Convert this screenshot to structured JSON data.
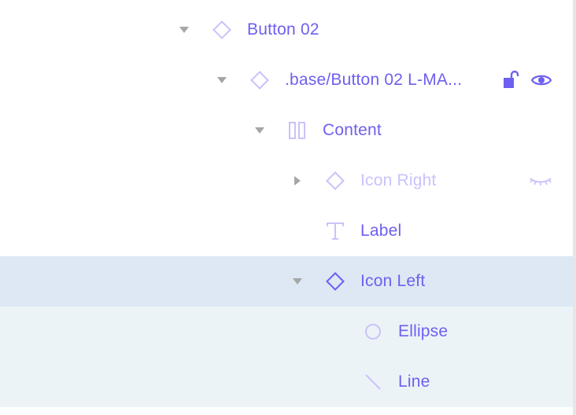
{
  "colors": {
    "accent": "#6e5ff0",
    "accent_light": "#c9c3fb",
    "caret": "#a6a6a6",
    "selected_bg": "#dde8f4",
    "child_bg": "#ebf3f7"
  },
  "layers": [
    {
      "name": "Button 02",
      "type": "component-instance",
      "icon": "diamond-icon",
      "depth": 0,
      "expanded": true,
      "hidden": false,
      "locked": null
    },
    {
      "name": ".base/Button 02 L-MA...",
      "type": "component-instance",
      "icon": "diamond-icon",
      "depth": 1,
      "expanded": true,
      "hidden": false,
      "locked": false,
      "visibility_icon": "eye-icon",
      "lock_icon": "unlock-icon"
    },
    {
      "name": "Content",
      "type": "frame",
      "icon": "auto-layout-icon",
      "depth": 2,
      "expanded": true,
      "hidden": false
    },
    {
      "name": "Icon Right",
      "type": "component-instance",
      "icon": "diamond-icon",
      "depth": 3,
      "expanded": false,
      "hidden": true,
      "visibility_icon": "eye-closed-icon"
    },
    {
      "name": "Label",
      "type": "text",
      "icon": "text-icon",
      "depth": 3,
      "expanded": null,
      "hidden": false
    },
    {
      "name": "Icon Left",
      "type": "component-instance",
      "icon": "diamond-icon",
      "depth": 3,
      "expanded": true,
      "hidden": false,
      "selected": true
    },
    {
      "name": "Ellipse",
      "type": "ellipse",
      "icon": "ellipse-icon",
      "depth": 4,
      "expanded": null,
      "hidden": false
    },
    {
      "name": "Line",
      "type": "line",
      "icon": "line-icon",
      "depth": 4,
      "expanded": null,
      "hidden": false
    }
  ]
}
